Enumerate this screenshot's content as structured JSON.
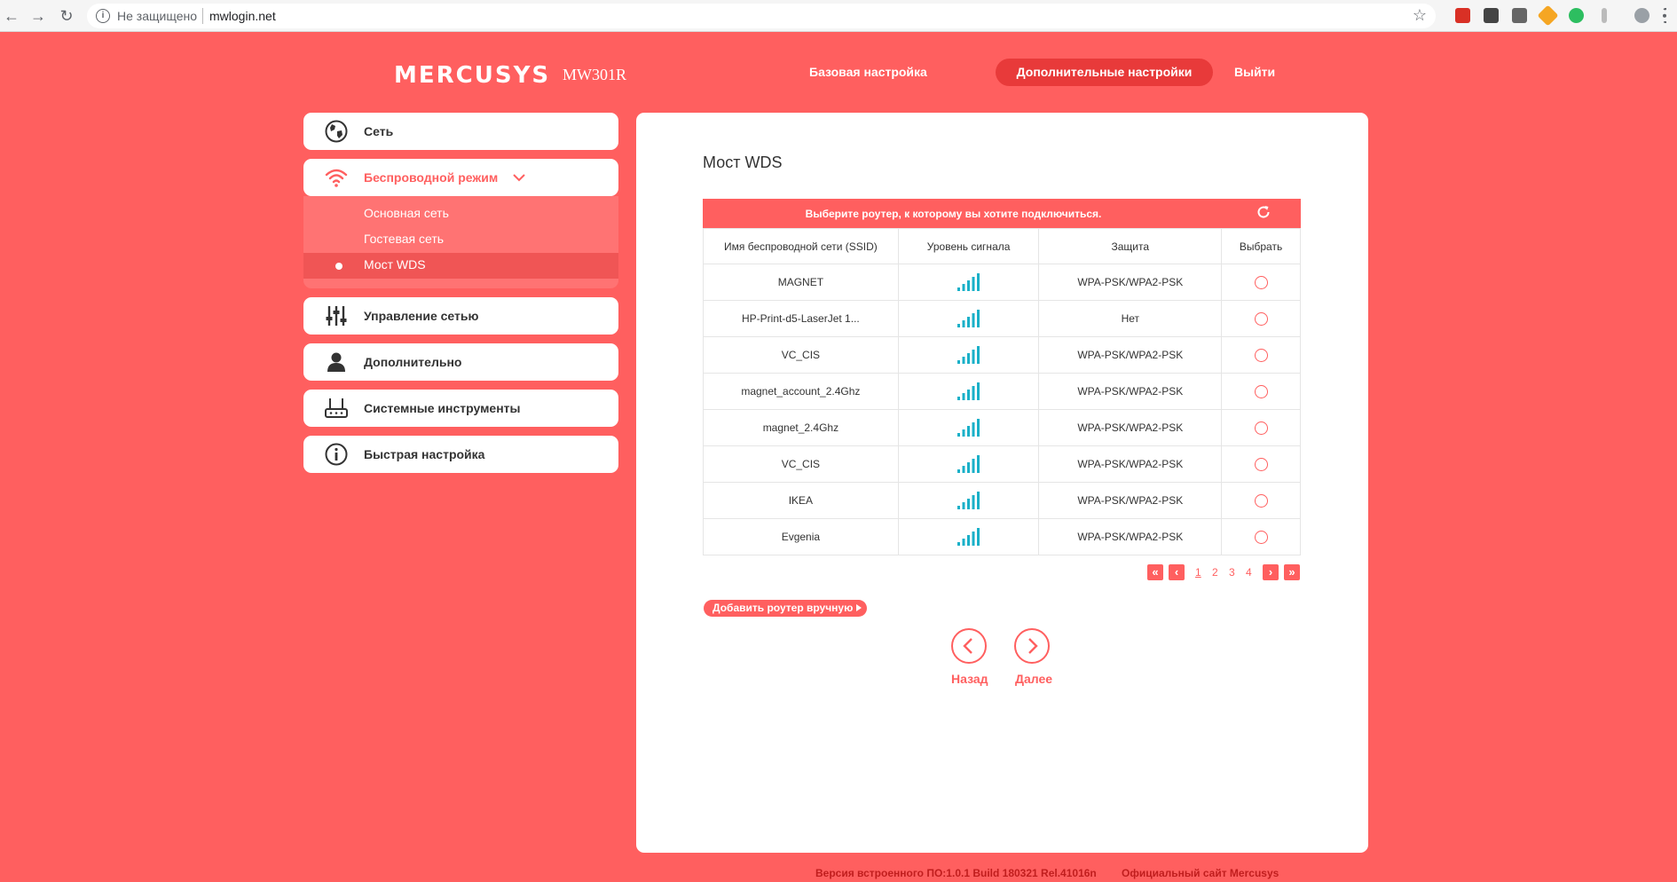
{
  "browser": {
    "security_label": "Не защищено",
    "url": "mwlogin.net",
    "back_glyph": "←",
    "forward_glyph": "→",
    "reload_glyph": "↻",
    "info_glyph": "i",
    "star_glyph": "☆"
  },
  "header": {
    "brand": "MERCUSYS",
    "model": "MW301R",
    "nav": {
      "basic": "Базовая настройка",
      "advanced": "Дополнительные настройки",
      "logout": "Выйти"
    }
  },
  "sidebar": {
    "network": "Сеть",
    "wireless": "Беспроводной режим",
    "wireless_sub": {
      "main": "Основная сеть",
      "guest": "Гостевая сеть",
      "wds": "Мост WDS"
    },
    "network_control": "Управление сетью",
    "advanced": "Дополнительно",
    "system_tools": "Системные инструменты",
    "quick_setup": "Быстрая настройка"
  },
  "panel": {
    "title": "Мост WDS",
    "prompt": "Выберите роутер, к которому вы хотите подключиться.",
    "columns": {
      "ssid": "Имя беспроводной сети (SSID)",
      "signal": "Уровень сигнала",
      "security": "Защита",
      "select": "Выбрать"
    },
    "rows": [
      {
        "ssid": "MAGNET",
        "security": "WPA-PSK/WPA2-PSK"
      },
      {
        "ssid": "HP-Print-d5-LaserJet 1...",
        "security": "Нет"
      },
      {
        "ssid": "VC_CIS",
        "security": "WPA-PSK/WPA2-PSK"
      },
      {
        "ssid": "magnet_account_2.4Ghz",
        "security": "WPA-PSK/WPA2-PSK"
      },
      {
        "ssid": "magnet_2.4Ghz",
        "security": "WPA-PSK/WPA2-PSK"
      },
      {
        "ssid": "VC_CIS",
        "security": "WPA-PSK/WPA2-PSK"
      },
      {
        "ssid": "IKEA",
        "security": "WPA-PSK/WPA2-PSK"
      },
      {
        "ssid": "Evgenia",
        "security": "WPA-PSK/WPA2-PSK"
      }
    ],
    "pagination": {
      "pages": [
        "1",
        "2",
        "3",
        "4"
      ],
      "current": "1"
    },
    "add_manual": "Добавить роутер вручную",
    "back": "Назад",
    "next": "Далее"
  },
  "footer": {
    "firmware": "Версия встроенного ПО:1.0.1 Build 180321 Rel.41016n",
    "site": "Официальный сайт Mercusys"
  },
  "colors": {
    "brand": "#ff5f5f",
    "signal": "#1ab0c8"
  }
}
